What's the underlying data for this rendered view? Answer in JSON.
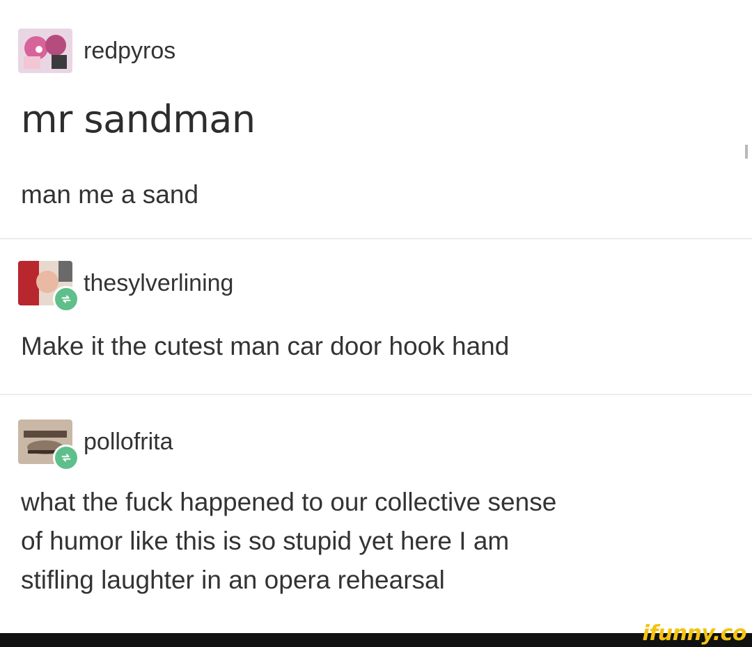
{
  "posts": [
    {
      "username": "redpyros",
      "title": "mr sandman",
      "body": "man me a sand",
      "avatar_icon": "anime-character-avatar-icon"
    },
    {
      "username": "thesylverlining",
      "body": "Make it the cutest man car door hook hand",
      "avatar_icon": "portrait-avatar-icon",
      "badge_icon": "reblog-icon"
    },
    {
      "username": "pollofrita",
      "body_lines": [
        "what the fuck happened to our collective sense",
        "of humor like this is so stupid yet here I am",
        "stifling laughter in an opera rehearsal"
      ],
      "avatar_icon": "face-avatar-icon",
      "badge_icon": "reblog-icon"
    }
  ],
  "watermark": "ifunny.co",
  "colors": {
    "reblog_badge": "#5fbf8a",
    "watermark": "#f4c312",
    "footer": "#111111"
  }
}
